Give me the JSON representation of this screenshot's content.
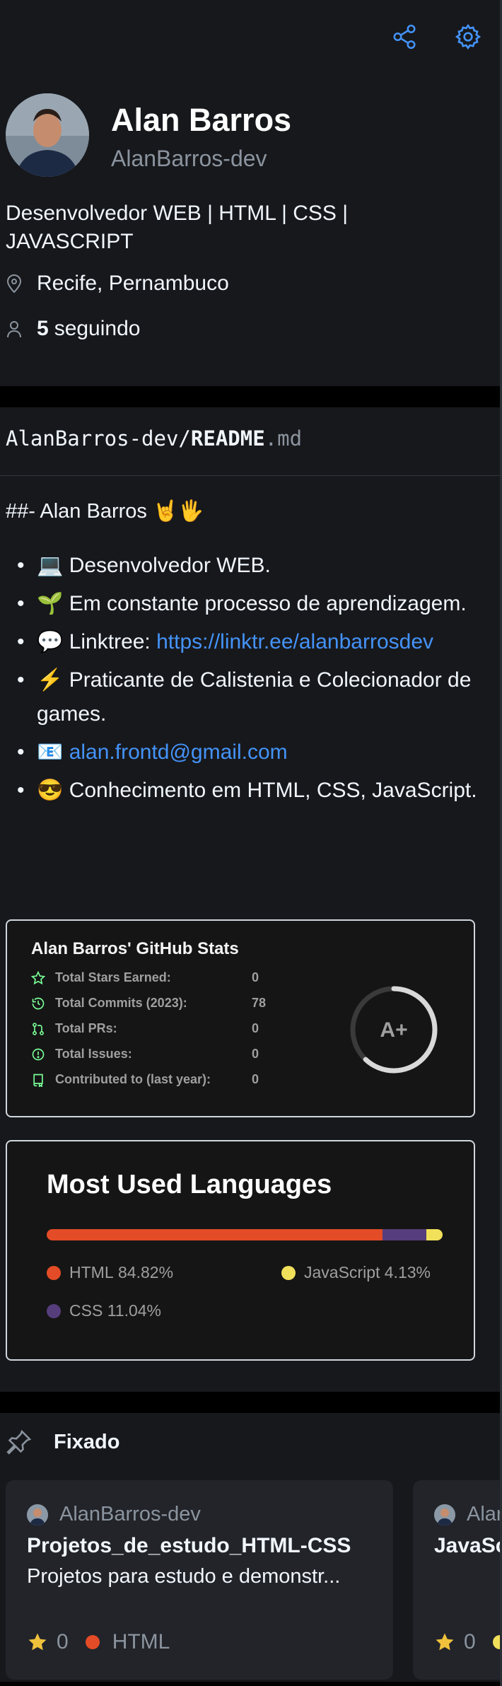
{
  "profile": {
    "name": "Alan Barros",
    "login": "AlanBarros-dev",
    "bio": "Desenvolvedor WEB | HTML | CSS | JAVASCRIPT",
    "location": "Recife, Pernambuco",
    "following_count": "5",
    "following_label": "seguindo"
  },
  "readme": {
    "owner": "AlanBarros-dev/",
    "file": "README",
    "ext": ".md",
    "heading": "##- Alan Barros 🤘🖐",
    "items": [
      {
        "emoji": "💻",
        "text": "Desenvolvedor WEB.",
        "link": ""
      },
      {
        "emoji": "🌱",
        "text": "Em constante processo de aprendizagem.",
        "link": ""
      },
      {
        "emoji": "💬",
        "text": "Linktree: ",
        "link": "https://linktr.ee/alanbarrosdev"
      },
      {
        "emoji": "⚡",
        "text": "Praticante de Calistenia e Colecionador de games.",
        "link": ""
      },
      {
        "emoji": "📧",
        "text": "",
        "link": "alan.frontd@gmail.com"
      },
      {
        "emoji": "😎",
        "text": "Conhecimento em HTML, CSS, JavaScript.",
        "link": ""
      }
    ]
  },
  "stats": {
    "title": "Alan Barros' GitHub Stats",
    "rows": [
      {
        "label": "Total Stars Earned:",
        "value": "0",
        "icon": "star-icon"
      },
      {
        "label": "Total Commits (2023):",
        "value": "78",
        "icon": "history-icon"
      },
      {
        "label": "Total PRs:",
        "value": "0",
        "icon": "pull-request-icon"
      },
      {
        "label": "Total Issues:",
        "value": "0",
        "icon": "issue-icon"
      },
      {
        "label": "Contributed to (last year):",
        "value": "0",
        "icon": "repo-icon"
      }
    ],
    "grade": "A+",
    "grade_progress": 0.62
  },
  "languages": {
    "title": "Most Used Languages",
    "items": [
      {
        "name": "HTML",
        "percent": "84.82%",
        "value": 84.82,
        "color": "#e34c26"
      },
      {
        "name": "CSS",
        "percent": "11.04%",
        "value": 11.04,
        "color": "#563d7c"
      },
      {
        "name": "JavaScript",
        "percent": "4.13%",
        "value": 4.13,
        "color": "#f1e05a"
      }
    ]
  },
  "pinned": {
    "title": "Fixado",
    "repos": [
      {
        "owner": "AlanBarros-dev",
        "name": "Projetos_de_estudo_HTML-CSS",
        "description": "Projetos para estudo e demonstr...",
        "stars": "0",
        "language": "HTML",
        "language_color": "#e34c26"
      },
      {
        "owner": "Alan",
        "name": "JavaSc",
        "description": "",
        "stars": "0",
        "language": "",
        "language_color": "#f1e05a"
      }
    ]
  },
  "colors": {
    "accent": "#4493f8",
    "background": "#17181c",
    "stat_icon": "#79ff97",
    "star": "#f0c23b"
  }
}
